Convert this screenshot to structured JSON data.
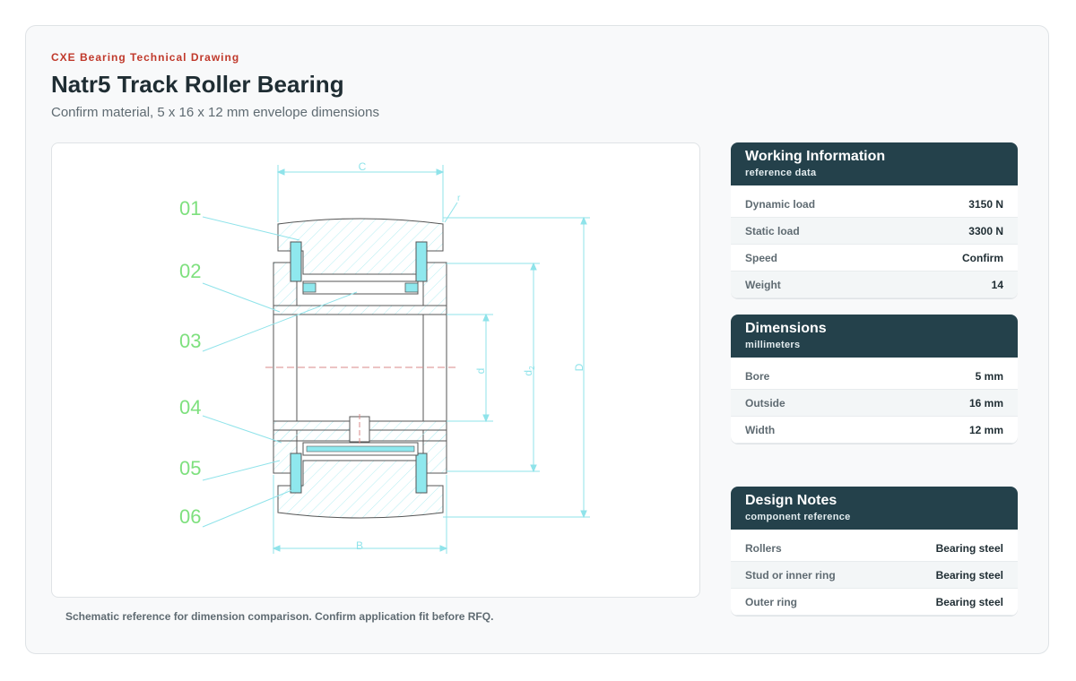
{
  "header": {
    "eyebrow": "CXE Bearing Technical Drawing",
    "title": "Natr5 Track Roller Bearing",
    "subtitle": "Confirm material, 5 x 16 x 12 mm envelope dimensions"
  },
  "drawing": {
    "callouts": [
      "01",
      "02",
      "03",
      "04",
      "05",
      "06"
    ],
    "dimension_labels": {
      "C": "C",
      "B": "B",
      "d": "d",
      "d2": "d",
      "d2_sub": "2",
      "D": "D",
      "r": "r"
    },
    "colors": {
      "callout": "#7ee07e",
      "dimension": "#8fe3ea",
      "outline": "#555555",
      "hatch": "#b6eef2",
      "fill": "#8fe8ee",
      "centerline": "#d98a8a"
    }
  },
  "caption": "Schematic reference for dimension comparison. Confirm application fit before RFQ.",
  "panels": {
    "working": {
      "title": "Working Information",
      "subtitle": "reference data",
      "rows": [
        {
          "label": "Dynamic load",
          "value": "3150 N"
        },
        {
          "label": "Static load",
          "value": "3300 N"
        },
        {
          "label": "Speed",
          "value": "Confirm"
        },
        {
          "label": "Weight",
          "value": "14"
        }
      ]
    },
    "dimensions": {
      "title": "Dimensions",
      "subtitle": "millimeters",
      "rows": [
        {
          "label": "Bore",
          "value": "5 mm"
        },
        {
          "label": "Outside",
          "value": "16 mm"
        },
        {
          "label": "Width",
          "value": "12 mm"
        }
      ]
    },
    "notes": {
      "title": "Design Notes",
      "subtitle": "component reference",
      "rows": [
        {
          "label": "Rollers",
          "value": "Bearing steel"
        },
        {
          "label": "Stud or inner ring",
          "value": "Bearing steel"
        },
        {
          "label": "Outer ring",
          "value": "Bearing steel"
        }
      ]
    }
  }
}
